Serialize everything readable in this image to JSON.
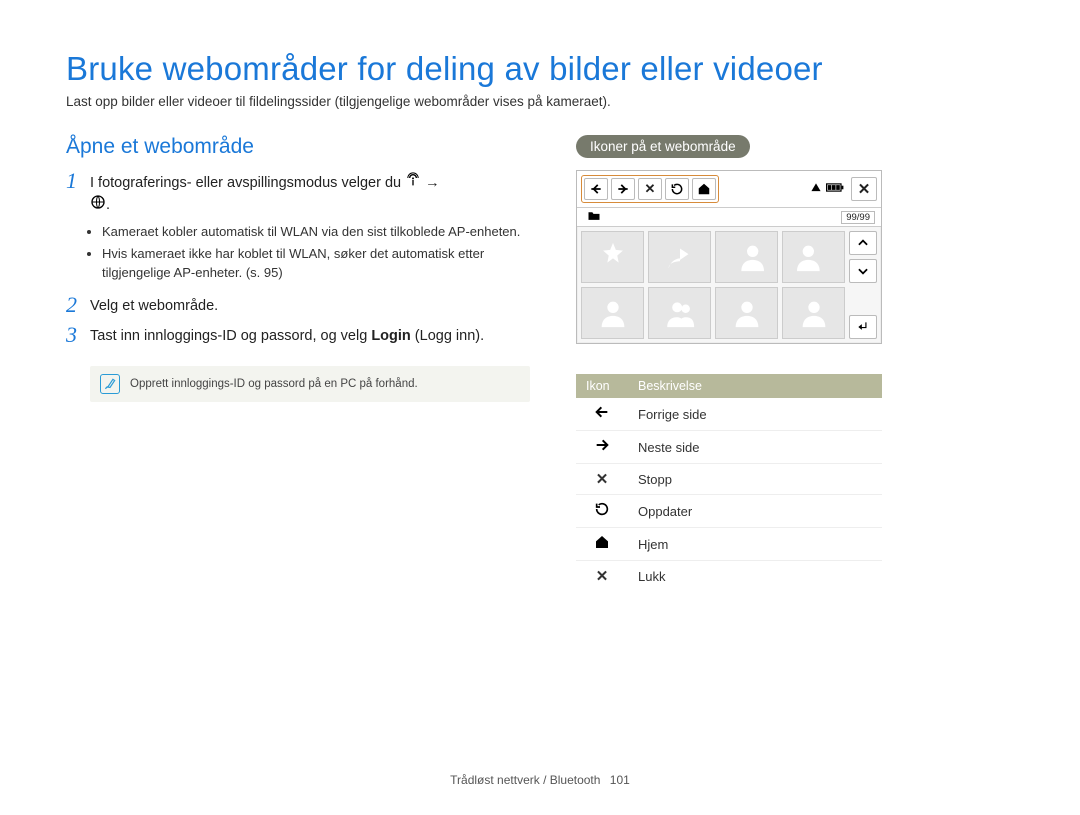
{
  "title": "Bruke webområder for deling av bilder eller videoer",
  "subtitle": "Last opp bilder eller videoer til fildelingssider (tilgjengelige webområder vises på kameraet).",
  "section_heading": "Åpne et webområde",
  "steps": {
    "s1": {
      "num": "1",
      "text_before": "I fotograferings- eller avspillingsmodus velger du ",
      "arrow": "→",
      "text_after": "."
    },
    "s2": {
      "num": "2",
      "text": "Velg et webområde."
    },
    "s3": {
      "num": "3",
      "text_a": "Tast inn innloggings-ID og passord, og velg ",
      "bold": "Login",
      "text_b": " (Logg inn)."
    }
  },
  "bullets": {
    "b1": "Kameraet kobler automatisk til WLAN via den sist tilkoblede AP-enheten.",
    "b2": "Hvis kameraet ikke har koblet til WLAN, søker det automatisk etter tilgjengelige AP-enheter. (s. 95)"
  },
  "note": "Opprett innloggings-ID og passord på en PC på forhånd.",
  "right": {
    "pill": "Ikoner på et webområde",
    "counter": "99/99"
  },
  "icon_table": {
    "h1": "Ikon",
    "h2": "Beskrivelse",
    "rows": [
      {
        "desc": "Forrige side"
      },
      {
        "desc": "Neste side"
      },
      {
        "desc": "Stopp"
      },
      {
        "desc": "Oppdater"
      },
      {
        "desc": "Hjem"
      },
      {
        "desc": "Lukk"
      }
    ]
  },
  "footer": {
    "section": "Trådløst nettverk / Bluetooth",
    "page": "101"
  }
}
